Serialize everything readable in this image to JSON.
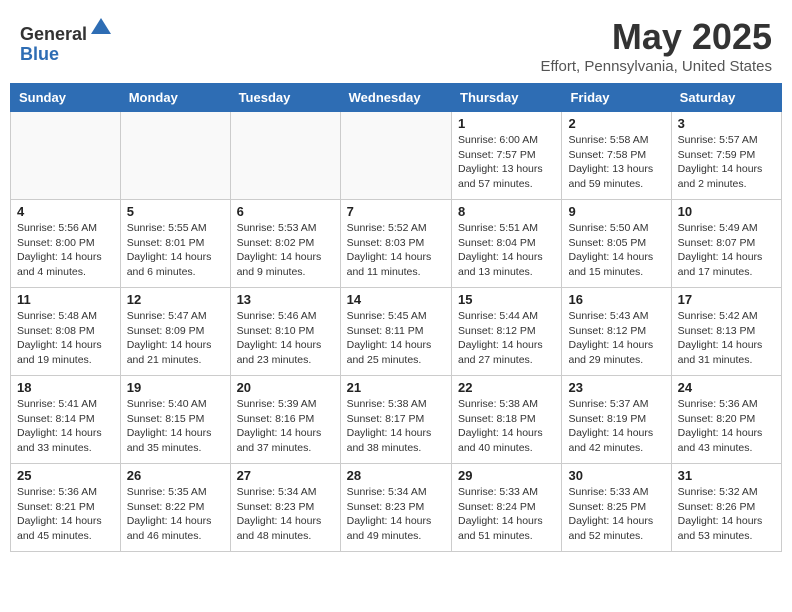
{
  "header": {
    "logo_general": "General",
    "logo_blue": "Blue",
    "title": "May 2025",
    "subtitle": "Effort, Pennsylvania, United States"
  },
  "weekdays": [
    "Sunday",
    "Monday",
    "Tuesday",
    "Wednesday",
    "Thursday",
    "Friday",
    "Saturday"
  ],
  "weeks": [
    [
      {
        "day": "",
        "info": ""
      },
      {
        "day": "",
        "info": ""
      },
      {
        "day": "",
        "info": ""
      },
      {
        "day": "",
        "info": ""
      },
      {
        "day": "1",
        "info": "Sunrise: 6:00 AM\nSunset: 7:57 PM\nDaylight: 13 hours\nand 57 minutes."
      },
      {
        "day": "2",
        "info": "Sunrise: 5:58 AM\nSunset: 7:58 PM\nDaylight: 13 hours\nand 59 minutes."
      },
      {
        "day": "3",
        "info": "Sunrise: 5:57 AM\nSunset: 7:59 PM\nDaylight: 14 hours\nand 2 minutes."
      }
    ],
    [
      {
        "day": "4",
        "info": "Sunrise: 5:56 AM\nSunset: 8:00 PM\nDaylight: 14 hours\nand 4 minutes."
      },
      {
        "day": "5",
        "info": "Sunrise: 5:55 AM\nSunset: 8:01 PM\nDaylight: 14 hours\nand 6 minutes."
      },
      {
        "day": "6",
        "info": "Sunrise: 5:53 AM\nSunset: 8:02 PM\nDaylight: 14 hours\nand 9 minutes."
      },
      {
        "day": "7",
        "info": "Sunrise: 5:52 AM\nSunset: 8:03 PM\nDaylight: 14 hours\nand 11 minutes."
      },
      {
        "day": "8",
        "info": "Sunrise: 5:51 AM\nSunset: 8:04 PM\nDaylight: 14 hours\nand 13 minutes."
      },
      {
        "day": "9",
        "info": "Sunrise: 5:50 AM\nSunset: 8:05 PM\nDaylight: 14 hours\nand 15 minutes."
      },
      {
        "day": "10",
        "info": "Sunrise: 5:49 AM\nSunset: 8:07 PM\nDaylight: 14 hours\nand 17 minutes."
      }
    ],
    [
      {
        "day": "11",
        "info": "Sunrise: 5:48 AM\nSunset: 8:08 PM\nDaylight: 14 hours\nand 19 minutes."
      },
      {
        "day": "12",
        "info": "Sunrise: 5:47 AM\nSunset: 8:09 PM\nDaylight: 14 hours\nand 21 minutes."
      },
      {
        "day": "13",
        "info": "Sunrise: 5:46 AM\nSunset: 8:10 PM\nDaylight: 14 hours\nand 23 minutes."
      },
      {
        "day": "14",
        "info": "Sunrise: 5:45 AM\nSunset: 8:11 PM\nDaylight: 14 hours\nand 25 minutes."
      },
      {
        "day": "15",
        "info": "Sunrise: 5:44 AM\nSunset: 8:12 PM\nDaylight: 14 hours\nand 27 minutes."
      },
      {
        "day": "16",
        "info": "Sunrise: 5:43 AM\nSunset: 8:12 PM\nDaylight: 14 hours\nand 29 minutes."
      },
      {
        "day": "17",
        "info": "Sunrise: 5:42 AM\nSunset: 8:13 PM\nDaylight: 14 hours\nand 31 minutes."
      }
    ],
    [
      {
        "day": "18",
        "info": "Sunrise: 5:41 AM\nSunset: 8:14 PM\nDaylight: 14 hours\nand 33 minutes."
      },
      {
        "day": "19",
        "info": "Sunrise: 5:40 AM\nSunset: 8:15 PM\nDaylight: 14 hours\nand 35 minutes."
      },
      {
        "day": "20",
        "info": "Sunrise: 5:39 AM\nSunset: 8:16 PM\nDaylight: 14 hours\nand 37 minutes."
      },
      {
        "day": "21",
        "info": "Sunrise: 5:38 AM\nSunset: 8:17 PM\nDaylight: 14 hours\nand 38 minutes."
      },
      {
        "day": "22",
        "info": "Sunrise: 5:38 AM\nSunset: 8:18 PM\nDaylight: 14 hours\nand 40 minutes."
      },
      {
        "day": "23",
        "info": "Sunrise: 5:37 AM\nSunset: 8:19 PM\nDaylight: 14 hours\nand 42 minutes."
      },
      {
        "day": "24",
        "info": "Sunrise: 5:36 AM\nSunset: 8:20 PM\nDaylight: 14 hours\nand 43 minutes."
      }
    ],
    [
      {
        "day": "25",
        "info": "Sunrise: 5:36 AM\nSunset: 8:21 PM\nDaylight: 14 hours\nand 45 minutes."
      },
      {
        "day": "26",
        "info": "Sunrise: 5:35 AM\nSunset: 8:22 PM\nDaylight: 14 hours\nand 46 minutes."
      },
      {
        "day": "27",
        "info": "Sunrise: 5:34 AM\nSunset: 8:23 PM\nDaylight: 14 hours\nand 48 minutes."
      },
      {
        "day": "28",
        "info": "Sunrise: 5:34 AM\nSunset: 8:23 PM\nDaylight: 14 hours\nand 49 minutes."
      },
      {
        "day": "29",
        "info": "Sunrise: 5:33 AM\nSunset: 8:24 PM\nDaylight: 14 hours\nand 51 minutes."
      },
      {
        "day": "30",
        "info": "Sunrise: 5:33 AM\nSunset: 8:25 PM\nDaylight: 14 hours\nand 52 minutes."
      },
      {
        "day": "31",
        "info": "Sunrise: 5:32 AM\nSunset: 8:26 PM\nDaylight: 14 hours\nand 53 minutes."
      }
    ]
  ]
}
